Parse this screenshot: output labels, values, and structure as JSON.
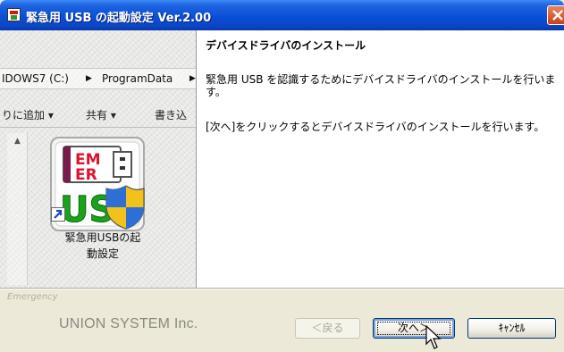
{
  "window": {
    "title": "緊急用 USB の起動設定 Ver.2.00"
  },
  "background": {
    "address_segments": [
      "IDOWS7 (C:)",
      "ProgramData"
    ],
    "toolbar_items": [
      "りに追加 ▾",
      "共有 ▾",
      "書き込"
    ],
    "icon": {
      "emblem_text_top": "EM",
      "emblem_text_bottom": "ER",
      "usb_text": "US",
      "label_line1": "緊急用USBの起",
      "label_line2": "動設定"
    }
  },
  "content": {
    "heading": "デバイスドライバのインストール",
    "paragraph1_line1": "緊急用 USB を認識するためにデバイスドライバのインストールを行いま",
    "paragraph1_line2": "す。",
    "paragraph2": "[次へ]をクリックするとデバイスドライバのインストールを行います。"
  },
  "footer": {
    "brand_small": "Emergency",
    "brand": "UNION SYSTEM Inc.",
    "back_label": "＜戻る",
    "next_label": "次へ＞",
    "cancel_label": "ｷｬﾝｾﾙ"
  },
  "colors": {
    "titlebar": "#0a4fd6",
    "close": "#d8572a",
    "emblem_red": "#e0122e",
    "usb_green": "#19a31c"
  }
}
